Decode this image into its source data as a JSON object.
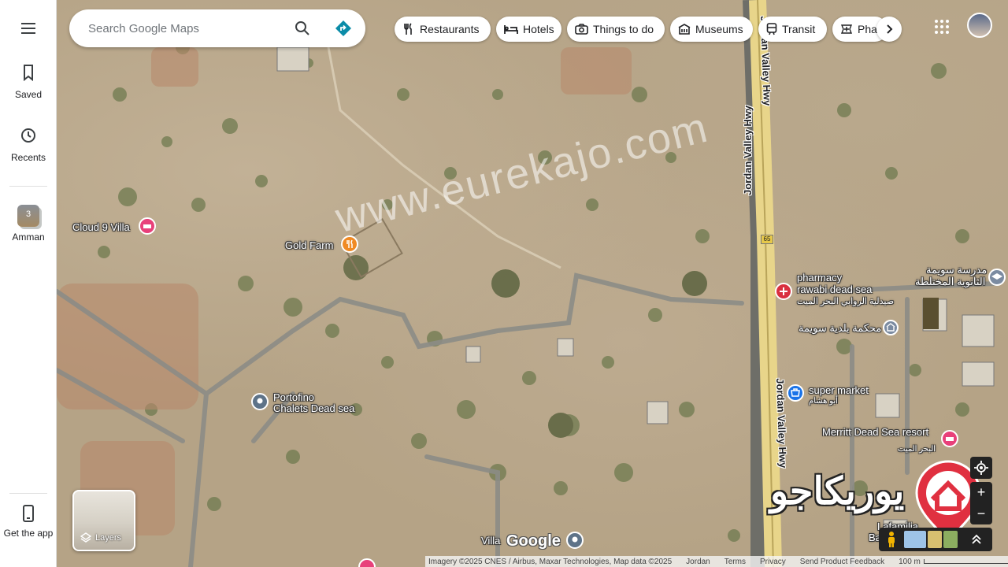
{
  "rail": {
    "saved_label": "Saved",
    "recents_label": "Recents",
    "recent_place_label": "Amman",
    "recent_place_count": "3",
    "get_app_label": "Get the app"
  },
  "search": {
    "placeholder": "Search Google Maps"
  },
  "chips": [
    {
      "label": "Restaurants",
      "icon": "fork-knife-icon"
    },
    {
      "label": "Hotels",
      "icon": "bed-icon"
    },
    {
      "label": "Things to do",
      "icon": "camera-icon"
    },
    {
      "label": "Museums",
      "icon": "museum-icon"
    },
    {
      "label": "Transit",
      "icon": "train-icon"
    },
    {
      "label": "Pharmacies",
      "icon": "pharmacy-icon"
    }
  ],
  "map": {
    "pois": {
      "cloud9": "Cloud 9 Villa",
      "gold_farm": "Gold Farm",
      "portofino_1": "Portofino",
      "portofino_2": "Chalets Dead sea",
      "pharmacy_1": "pharmacy",
      "pharmacy_2": "rawabi dead sea",
      "pharmacy_ar": "صيدلية الروابي البحر الميت",
      "court_ar": "محكمة بلدية سويمة",
      "school_ar_1": "مدرسة سويمة",
      "school_ar_2": "الثانوية المختلطة",
      "super_market": "super market",
      "super_market_ar": "أبو هشام",
      "merritt": "Merritt Dead Sea resort",
      "merritt_ar": "البحر الميت",
      "lafamilia": "Lafamilia",
      "badwa": "Badwa",
      "villa": "Villa"
    },
    "roads": {
      "hwy_upper": "Jordan Valley Hwy",
      "hwy_lower": "Jordan Valley Hwy",
      "route_number": "65"
    },
    "watermark": "www.eurekajo.com",
    "watermark_ar": "يوريكاجو"
  },
  "layers_label": "Layers",
  "google_logo": "Google",
  "footer": {
    "imagery": "Imagery ©2025 CNES / Airbus, Maxar Technologies, Map data ©2025",
    "country": "Jordan",
    "terms": "Terms",
    "privacy": "Privacy",
    "feedback": "Send Product Feedback",
    "scale": "100 m"
  },
  "colors": {
    "accent_blue": "#1a73e8",
    "directions_teal": "#0b8ca8",
    "hotel_pink": "#e8407a",
    "food_orange": "#f08a24",
    "pharmacy_red": "#d93040",
    "shop_blue": "#1a73e8"
  }
}
